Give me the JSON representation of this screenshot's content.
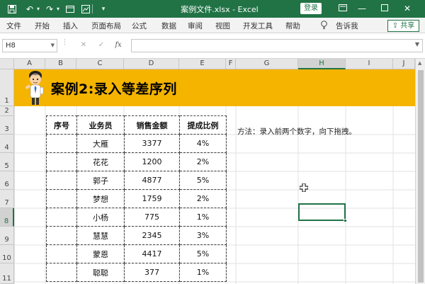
{
  "titlebar": {
    "title": "案例文件.xlsx  -  Excel",
    "login": "登录",
    "icons": [
      "save-icon",
      "undo-icon",
      "redo-icon",
      "view-icon",
      "ink-icon",
      "customize-icon"
    ],
    "win_controls": [
      "ribbon-display-icon",
      "minimize-icon",
      "maximize-icon",
      "close-icon"
    ]
  },
  "ribbon": {
    "tabs": [
      "文件",
      "开始",
      "插入",
      "页面布局",
      "公式",
      "数据",
      "审阅",
      "视图",
      "开发工具",
      "帮助"
    ],
    "tell_me": "告诉我",
    "share": "共享"
  },
  "formula_bar": {
    "name_box": "H8",
    "fx": "fx",
    "value": ""
  },
  "columns": [
    "A",
    "B",
    "C",
    "D",
    "E",
    "F",
    "G",
    "H",
    "I",
    "J"
  ],
  "active_column": "H",
  "rows": [
    "1",
    "2",
    "3",
    "4",
    "5",
    "6",
    "7",
    "8",
    "9",
    "10",
    "11"
  ],
  "active_row": "8",
  "banner": {
    "title": "案例2:录入等差序列",
    "color": "#f4b400"
  },
  "table": {
    "headers": [
      "序号",
      "业务员",
      "销售金额",
      "提成比例"
    ],
    "rows": [
      [
        "",
        "大雁",
        "3377",
        "4%"
      ],
      [
        "",
        "花花",
        "1200",
        "2%"
      ],
      [
        "",
        "郭子",
        "4877",
        "5%"
      ],
      [
        "",
        "梦想",
        "1759",
        "2%"
      ],
      [
        "",
        "小杨",
        "775",
        "1%"
      ],
      [
        "",
        "慧慧",
        "2345",
        "3%"
      ],
      [
        "",
        "蒙恩",
        "4417",
        "5%"
      ],
      [
        "",
        "聪聪",
        "377",
        "1%"
      ]
    ]
  },
  "note": "方法：录入前两个数字，向下拖拽。",
  "colors": {
    "excel_green": "#217346",
    "banner_yellow": "#f4b400"
  }
}
